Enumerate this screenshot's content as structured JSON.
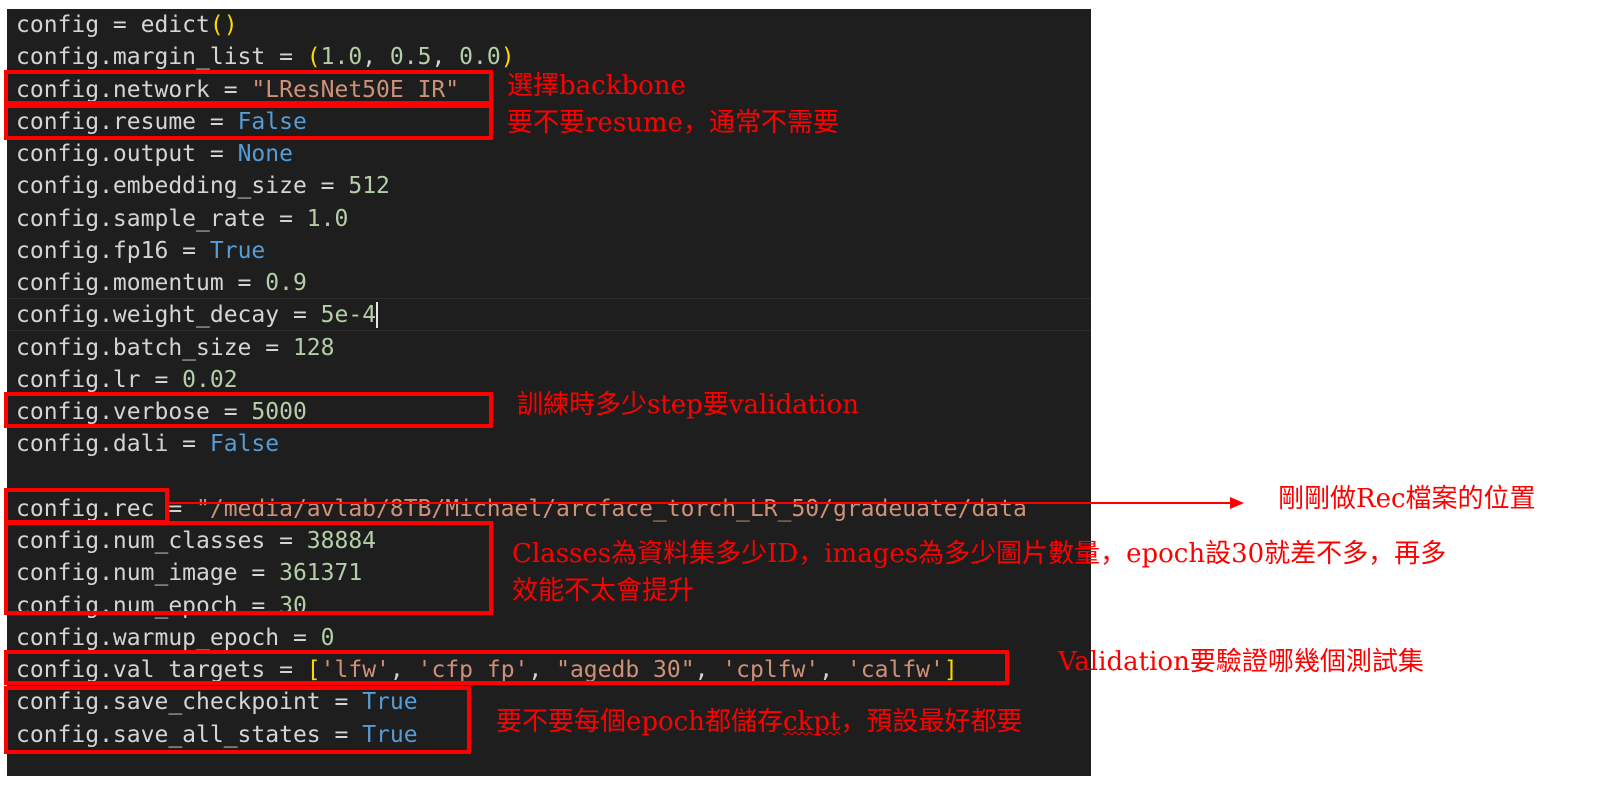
{
  "code_lines": [
    {
      "tokens": [
        {
          "t": "config = edict"
        },
        {
          "t": "()",
          "c": "p"
        }
      ]
    },
    {
      "tokens": [
        {
          "t": "config.margin_list = "
        },
        {
          "t": "(",
          "c": "p"
        },
        {
          "t": "1.0",
          "c": "num"
        },
        {
          "t": ", "
        },
        {
          "t": "0.5",
          "c": "num"
        },
        {
          "t": ", "
        },
        {
          "t": "0.0",
          "c": "num"
        },
        {
          "t": ")",
          "c": "p"
        }
      ]
    },
    {
      "tokens": [
        {
          "t": "config.network = "
        },
        {
          "t": "\"LResNet50E_IR\"",
          "c": "str"
        }
      ]
    },
    {
      "tokens": [
        {
          "t": "config.resume = "
        },
        {
          "t": "False",
          "c": "kw"
        }
      ]
    },
    {
      "tokens": [
        {
          "t": "config.output = "
        },
        {
          "t": "None",
          "c": "kw"
        }
      ]
    },
    {
      "tokens": [
        {
          "t": "config.embedding_size = "
        },
        {
          "t": "512",
          "c": "num"
        }
      ]
    },
    {
      "tokens": [
        {
          "t": "config.sample_rate = "
        },
        {
          "t": "1.0",
          "c": "num"
        }
      ]
    },
    {
      "tokens": [
        {
          "t": "config.fp16 = "
        },
        {
          "t": "True",
          "c": "kw"
        }
      ]
    },
    {
      "tokens": [
        {
          "t": "config.momentum = "
        },
        {
          "t": "0.9",
          "c": "num"
        }
      ]
    },
    {
      "tokens": [
        {
          "t": "config.weight_decay = "
        },
        {
          "t": "5e-",
          "c": "num"
        },
        {
          "t": "4",
          "c": "caret"
        }
      ]
    },
    {
      "tokens": [
        {
          "t": "config.batch_size = "
        },
        {
          "t": "128",
          "c": "num"
        }
      ]
    },
    {
      "tokens": [
        {
          "t": "config.lr = "
        },
        {
          "t": "0.02",
          "c": "num"
        }
      ]
    },
    {
      "tokens": [
        {
          "t": "config.verbose = "
        },
        {
          "t": "5000",
          "c": "num"
        }
      ]
    },
    {
      "tokens": [
        {
          "t": "config.dali = "
        },
        {
          "t": "False",
          "c": "kw"
        }
      ]
    },
    {
      "tokens": []
    },
    {
      "tokens": [
        {
          "t": "config.rec = "
        },
        {
          "t": "\"/media/avlab/8TB/Michael/arcface_torch_LR_50/gradeuate/data",
          "c": "str"
        }
      ]
    },
    {
      "tokens": [
        {
          "t": "config.num_classes = "
        },
        {
          "t": "38884",
          "c": "num"
        }
      ]
    },
    {
      "tokens": [
        {
          "t": "config.num_image = "
        },
        {
          "t": "361371",
          "c": "num"
        }
      ]
    },
    {
      "tokens": [
        {
          "t": "config.num_epoch = "
        },
        {
          "t": "30",
          "c": "num"
        }
      ]
    },
    {
      "tokens": [
        {
          "t": "config.warmup_epoch = "
        },
        {
          "t": "0",
          "c": "num"
        }
      ]
    },
    {
      "tokens": [
        {
          "t": "config.val_targets = "
        },
        {
          "t": "[",
          "c": "p"
        },
        {
          "t": "'lfw'",
          "c": "str"
        },
        {
          "t": ", "
        },
        {
          "t": "'cfp_fp'",
          "c": "str"
        },
        {
          "t": ", "
        },
        {
          "t": "\"agedb_30\"",
          "c": "str"
        },
        {
          "t": ", "
        },
        {
          "t": "'cplfw'",
          "c": "str"
        },
        {
          "t": ", "
        },
        {
          "t": "'calfw'",
          "c": "str"
        },
        {
          "t": "]",
          "c": "p"
        }
      ]
    },
    {
      "tokens": [
        {
          "t": "config.save_checkpoint = "
        },
        {
          "t": "True",
          "c": "kw"
        }
      ]
    },
    {
      "tokens": [
        {
          "t": "config.save_all_states = "
        },
        {
          "t": "True",
          "c": "kw"
        }
      ]
    }
  ],
  "annotations": {
    "backbone": "選擇backbone",
    "resume": "要不要resume，通常不需要",
    "verbose": "訓練時多少step要validation",
    "rec": "剛剛做Rec檔案的位置",
    "classes_line1": "Classes為資料集多少ID，images為多少圖片數量，epoch設30就差不多，再多",
    "classes_line2": "效能不太會提升",
    "val_targets": "Validation要驗證哪幾個測試集",
    "save_prefix": "要不要每個epoch都儲存",
    "save_ckpt": "ckpt",
    "save_suffix": "，預設最好都要"
  },
  "colors": {
    "editor_bg": "#1e1e1e",
    "identifier": "#d4d4d4",
    "string": "#ce9178",
    "number": "#b5cea8",
    "keyword": "#569cd6",
    "bracket": "#ffd700",
    "annotation": "#ff0000"
  }
}
